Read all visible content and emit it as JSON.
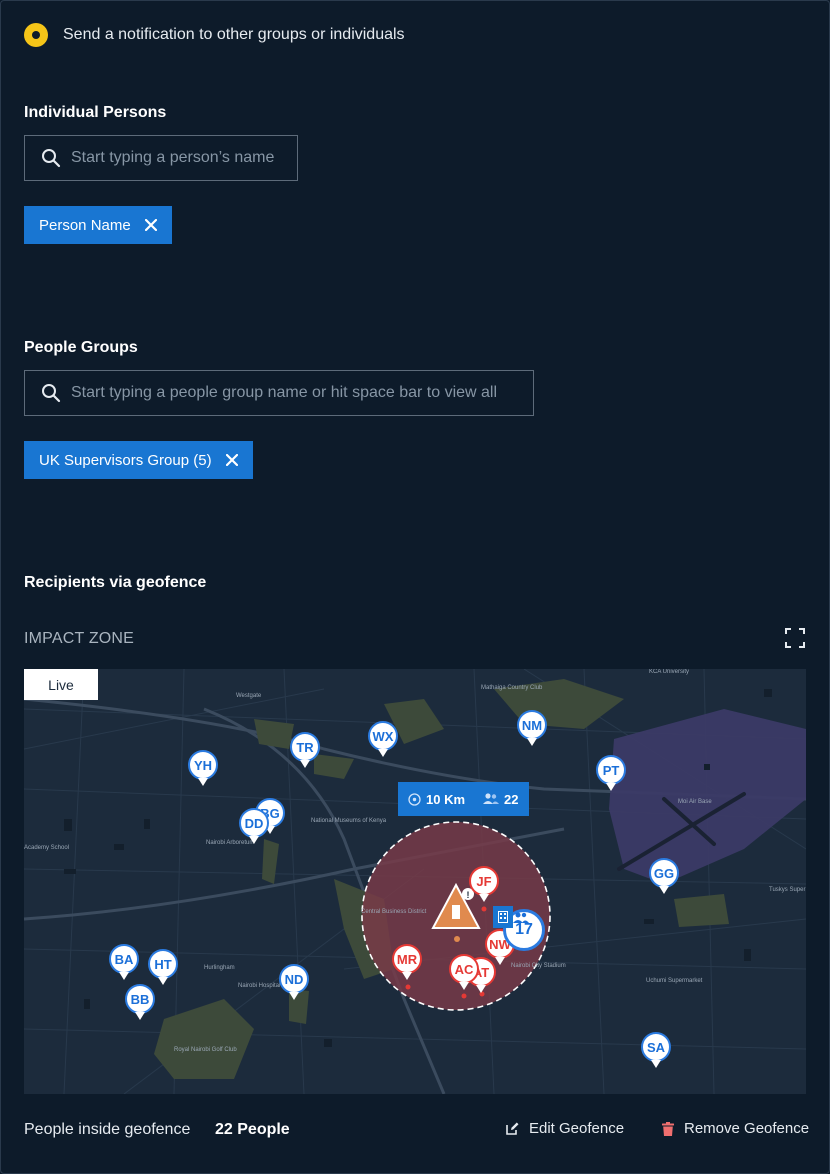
{
  "notification": {
    "label": "Send a notification to other groups or individuals"
  },
  "individuals": {
    "title": "Individual Persons",
    "placeholder": "Start typing a person’s name",
    "chips": [
      {
        "label": "Person Name"
      }
    ]
  },
  "groups": {
    "title": "People Groups",
    "placeholder": "Start typing a people group name or hit space bar to view all",
    "chips": [
      {
        "label": "UK Supervisors Group (5)"
      }
    ]
  },
  "geofence": {
    "title": "Recipients via geofence",
    "impact_label": "IMPACT ZONE",
    "live_label": "Live",
    "radius": "10 Km",
    "people_in_zone": "22",
    "cluster_count": "17",
    "pins_outside": [
      "YH",
      "TR",
      "WX",
      "NM",
      "PT",
      "BG",
      "DD",
      "GG",
      "BA",
      "HT",
      "BB",
      "ND",
      "SA"
    ],
    "pins_inside": [
      "JF",
      "NW",
      "MR",
      "AC",
      "AT"
    ],
    "map_labels": [
      "Westgate",
      "Mathaiga Country Club",
      "National Museums of Kenya",
      "Nairobi Arboretum",
      "Central Business District",
      "Nairobi City Stadium",
      "Hurlingham",
      "Nairobi Hospital",
      "Royal Nairobi Golf Club",
      "Moi Air Base",
      "Uchumi Supermarket",
      "Tuskys Super",
      "Academy School",
      "KCA University"
    ],
    "colors": {
      "zone_fill": "#7a3b48",
      "pin_blue": "#2b7be0",
      "pin_red": "#e53935",
      "hazard": "#e08a4e"
    }
  },
  "footer": {
    "label": "People inside geofence",
    "count": "22 People",
    "edit_label": "Edit Geofence",
    "remove_label": "Remove Geofence"
  }
}
